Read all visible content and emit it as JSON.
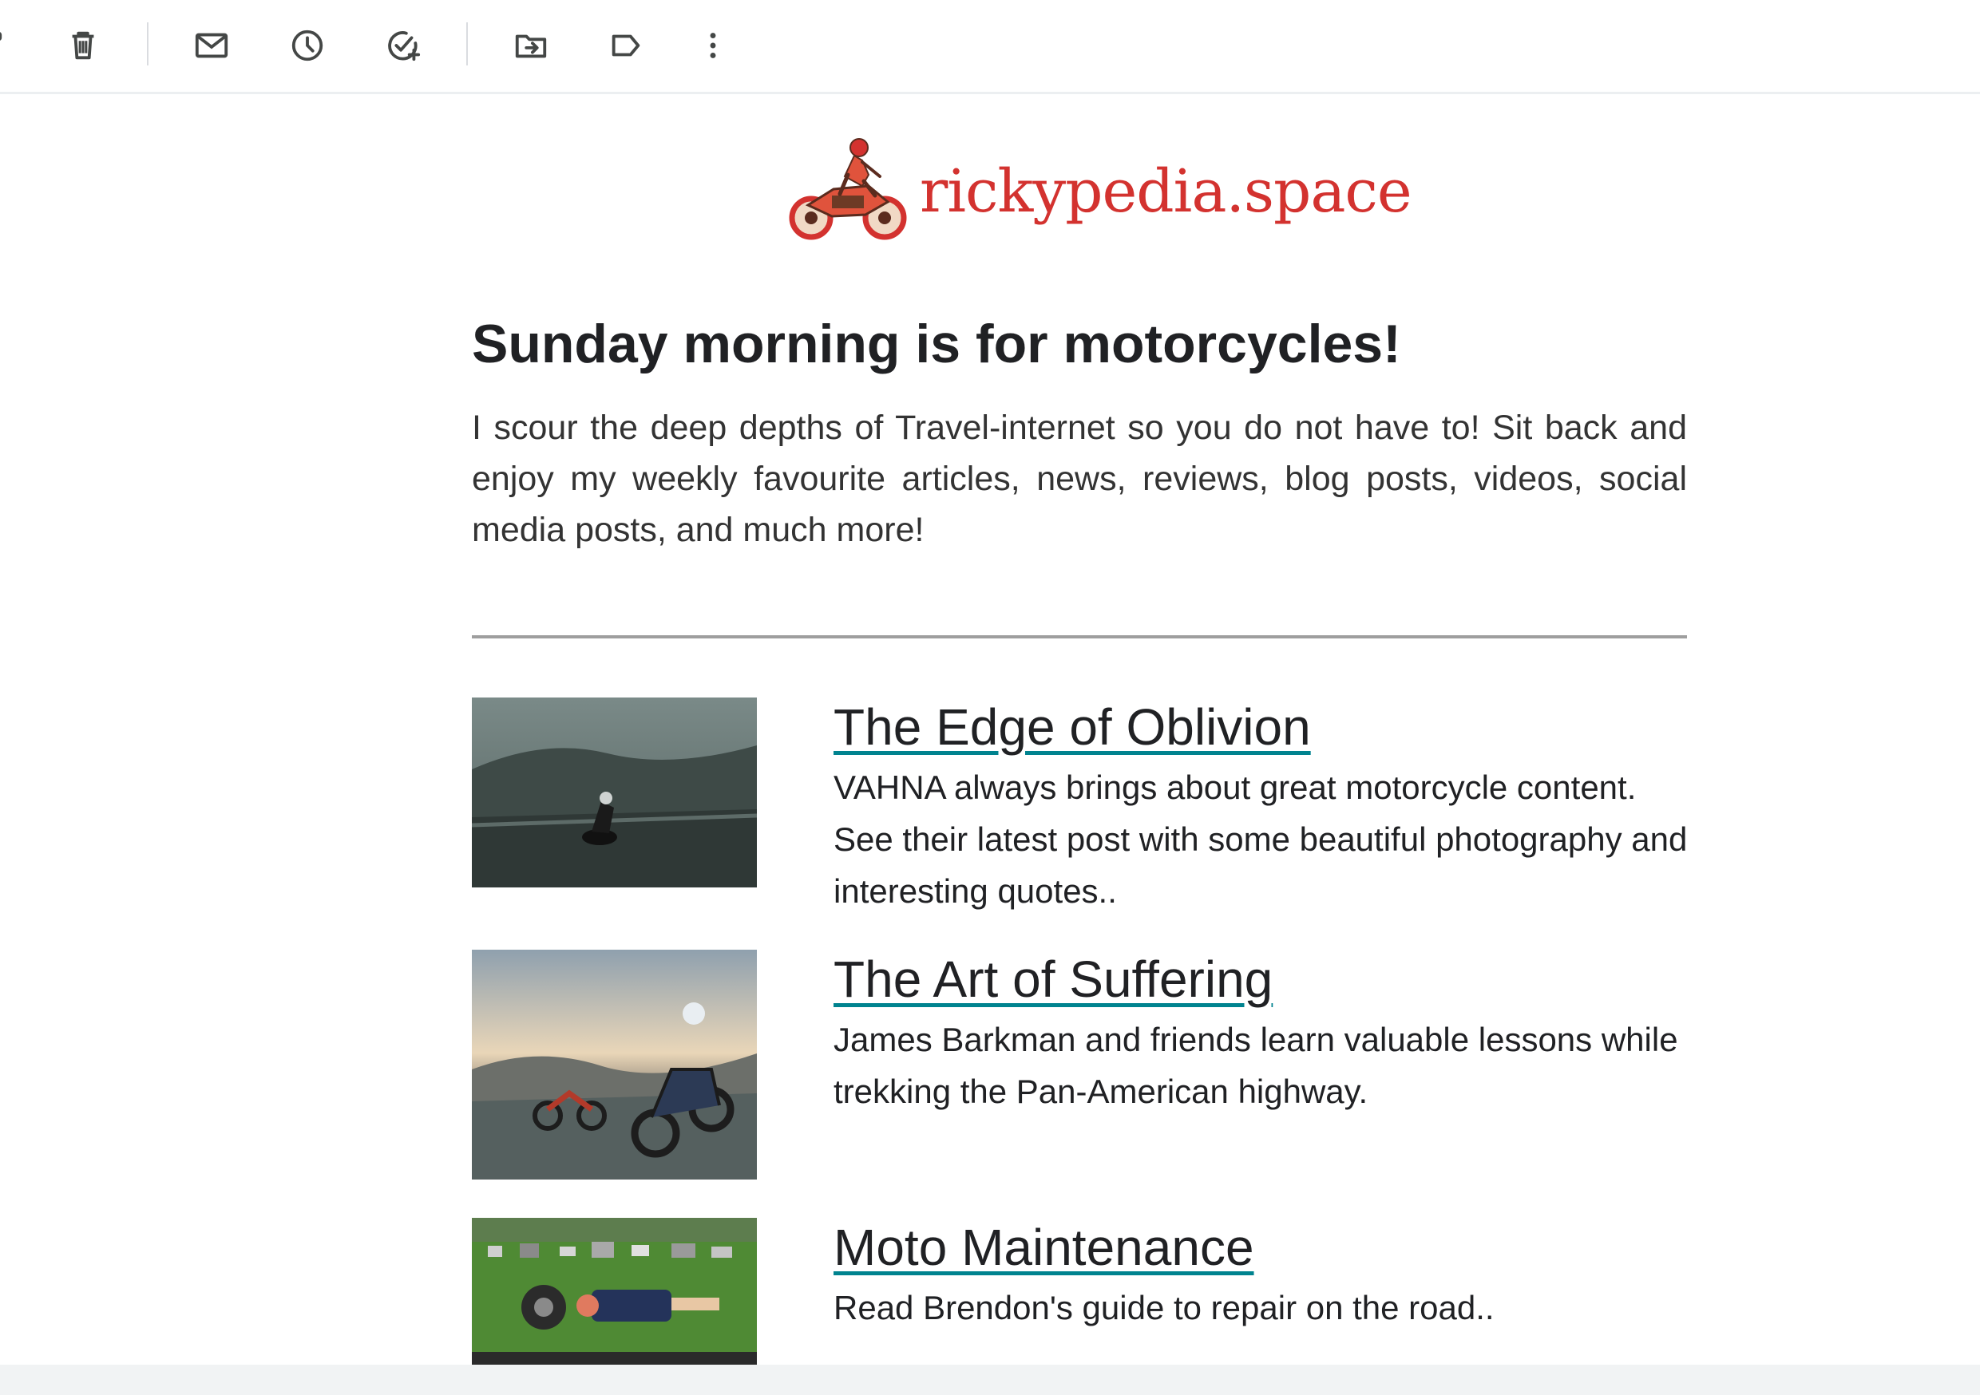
{
  "toolbar": {
    "icons": [
      "archive-icon",
      "delete-icon",
      "mark-unread-icon",
      "snooze-icon",
      "add-task-icon",
      "move-to-icon",
      "label-icon",
      "more-vert-icon"
    ]
  },
  "newsletter": {
    "logo_text": "rickypedia.space",
    "headline": "Sunday morning is for motorcycles!",
    "intro": "I scour the deep depths of Travel-internet so you do not have to! Sit back and enjoy my weekly favourite articles, news, reviews, blog posts, videos, social media posts, and much more!",
    "articles": [
      {
        "title": "The Edge of Oblivion",
        "description": "VAHNA always brings about great motorcycle content. See their latest post with some beautiful photography and interesting quotes.."
      },
      {
        "title": "The Art of Suffering",
        "description": "James Barkman and friends learn valuable lessons while trekking the Pan-American highway."
      },
      {
        "title": "Moto Maintenance",
        "description": "Read Brendon's guide to repair on the road.."
      }
    ]
  },
  "colors": {
    "brand_red": "#d3322f",
    "link_underline": "#00838f",
    "text": "#202124",
    "divider": "#9e9e9e"
  }
}
